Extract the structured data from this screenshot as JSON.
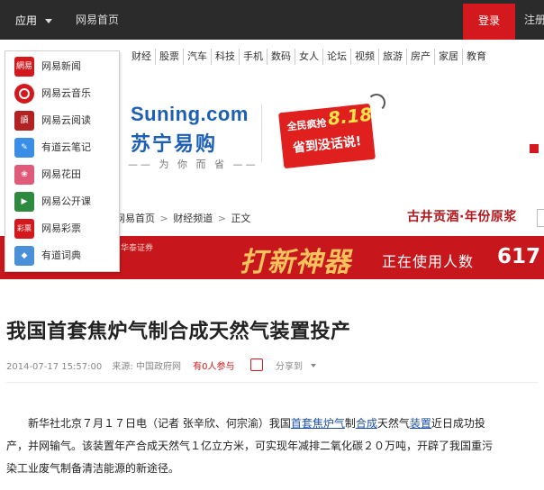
{
  "topbar": {
    "app_menu": "应用",
    "home": "网易首页",
    "login": "登录",
    "register": "注册"
  },
  "app_menu": {
    "items": [
      {
        "icon": "netease-news-icon",
        "icon_text": "網易",
        "color": "#d3191d",
        "label": "网易新闻"
      },
      {
        "icon": "cloud-music-icon",
        "icon_text": "",
        "color": "#d3191d",
        "label": "网易云音乐"
      },
      {
        "icon": "cloud-reading-icon",
        "icon_text": "讀",
        "color": "#b22222",
        "label": "网易云阅读"
      },
      {
        "icon": "youdao-note-icon",
        "icon_text": "✎",
        "color": "#3a8ee6",
        "label": "有道云笔记"
      },
      {
        "icon": "huatian-icon",
        "icon_text": "❀",
        "color": "#e05a7a",
        "label": "网易花田"
      },
      {
        "icon": "open-course-icon",
        "icon_text": "▶",
        "color": "#2d8a3e",
        "label": "网易公开课"
      },
      {
        "icon": "lottery-icon",
        "icon_text": "彩票",
        "color": "#d3191d",
        "label": "网易彩票"
      },
      {
        "icon": "youdao-dict-icon",
        "icon_text": "◆",
        "color": "#4a90d9",
        "label": "有道词典"
      }
    ]
  },
  "channels": [
    "财经",
    "股票",
    "汽车",
    "科技",
    "手机",
    "数码",
    "女人",
    "论坛",
    "视频",
    "旅游",
    "房产",
    "家居",
    "教育"
  ],
  "ad": {
    "logo": "Suning.com",
    "logo_cn": "苏宁易购",
    "slogan": "—— 为 你 而 省 ——",
    "promo_line1": "全民疯抢",
    "promo_date": "8.18",
    "promo_line2": "省到没话说!"
  },
  "breadcrumb": [
    "网易首页",
    "财经频道",
    "正文"
  ],
  "breadcrumb_sep": ">",
  "wine_ad": "古井贡酒·年份原浆",
  "banner": {
    "brand": "华泰证券",
    "title": "打新神器",
    "using": "正在使用人数",
    "count": "617"
  },
  "article": {
    "title": "我国首套焦炉气制合成天然气装置投产",
    "date": "2014-07-17 15:57:00",
    "source": "来源: 中国政府网",
    "participants": "有0人参与",
    "share": "分享到",
    "body_prefix": "新华社北京７月１７日电（记者 张辛欣、何宗渝）我国",
    "kw1": "首套焦炉气",
    "body_mid1": "制",
    "kw2": "合成",
    "body_mid2": "天然气",
    "kw3": "装置",
    "body_suffix": "近日成功投产，并网输气。该装置年产合成天然气１亿立方米，可实现年减排二氧化碳２０万吨，开辟了我国重污染工业废气制备清洁能源的新途径。"
  }
}
